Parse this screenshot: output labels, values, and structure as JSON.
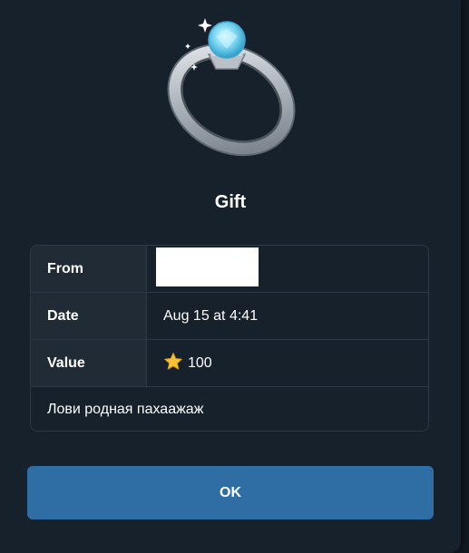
{
  "dialog": {
    "icon": "diamond-ring-icon",
    "title": "Gift",
    "rows": [
      {
        "label": "From",
        "value": ""
      },
      {
        "label": "Date",
        "value": "Aug 15 at 4:41"
      },
      {
        "label": "Value",
        "value": "100",
        "icon": "star-icon"
      }
    ],
    "message": "Лови родная пахаажаж",
    "ok_label": "OK"
  },
  "colors": {
    "background": "#17212b",
    "label_cell": "#202b36",
    "border": "#2c3845",
    "button": "#2f6ea5",
    "text": "#ffffff"
  }
}
